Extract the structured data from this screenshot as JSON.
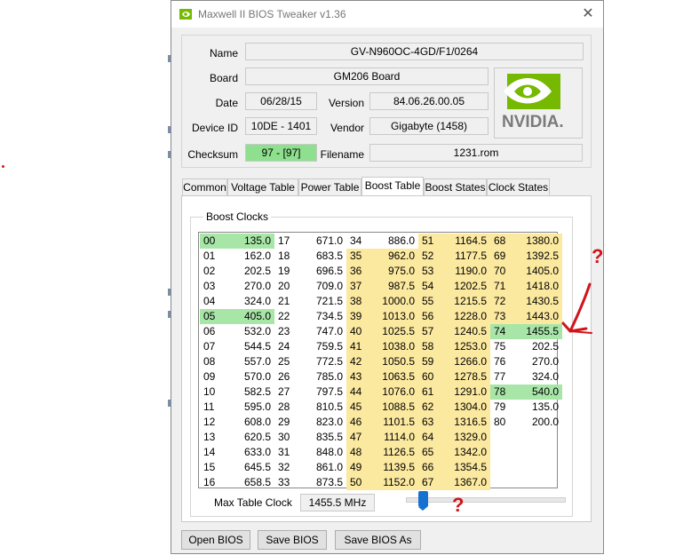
{
  "window": {
    "title": "Maxwell II BIOS Tweaker v1.36",
    "close_glyph": "✕"
  },
  "info": {
    "name_label": "Name",
    "name_value": "GV-N960OC-4GD/F1/0264",
    "board_label": "Board",
    "board_value": "GM206 Board",
    "date_label": "Date",
    "date_value": "06/28/15",
    "version_label": "Version",
    "version_value": "84.06.26.00.05",
    "device_label": "Device ID",
    "device_value": "10DE - 1401",
    "vendor_label": "Vendor",
    "vendor_value": "Gigabyte (1458)",
    "checksum_label": "Checksum",
    "checksum_value": "97 - [97]",
    "filename_label": "Filename",
    "filename_value": "1231.rom",
    "logo_text": "NVIDIA.",
    "logo_color": "#76b900"
  },
  "tabs": [
    "Common",
    "Voltage Table",
    "Power Table",
    "Boost Table",
    "Boost States",
    "Clock States"
  ],
  "active_tab": "Boost Table",
  "boost": {
    "group_title": "Boost Clocks",
    "columns": [
      [
        [
          "00",
          "135.0",
          "g"
        ],
        [
          "01",
          "162.0",
          ""
        ],
        [
          "02",
          "202.5",
          ""
        ],
        [
          "03",
          "270.0",
          ""
        ],
        [
          "04",
          "324.0",
          ""
        ],
        [
          "05",
          "405.0",
          "g"
        ],
        [
          "06",
          "532.0",
          ""
        ],
        [
          "07",
          "544.5",
          ""
        ],
        [
          "08",
          "557.0",
          ""
        ],
        [
          "09",
          "570.0",
          ""
        ],
        [
          "10",
          "582.5",
          ""
        ],
        [
          "11",
          "595.0",
          ""
        ],
        [
          "12",
          "608.0",
          ""
        ],
        [
          "13",
          "620.5",
          ""
        ],
        [
          "14",
          "633.0",
          ""
        ],
        [
          "15",
          "645.5",
          ""
        ],
        [
          "16",
          "658.5",
          ""
        ]
      ],
      [
        [
          "17",
          "671.0",
          ""
        ],
        [
          "18",
          "683.5",
          ""
        ],
        [
          "19",
          "696.5",
          ""
        ],
        [
          "20",
          "709.0",
          ""
        ],
        [
          "21",
          "721.5",
          ""
        ],
        [
          "22",
          "734.5",
          ""
        ],
        [
          "23",
          "747.0",
          ""
        ],
        [
          "24",
          "759.5",
          ""
        ],
        [
          "25",
          "772.5",
          ""
        ],
        [
          "26",
          "785.0",
          ""
        ],
        [
          "27",
          "797.5",
          ""
        ],
        [
          "28",
          "810.5",
          ""
        ],
        [
          "29",
          "823.0",
          ""
        ],
        [
          "30",
          "835.5",
          ""
        ],
        [
          "31",
          "848.0",
          ""
        ],
        [
          "32",
          "861.0",
          ""
        ],
        [
          "33",
          "873.5",
          ""
        ]
      ],
      [
        [
          "34",
          "886.0",
          ""
        ],
        [
          "35",
          "962.0",
          "y"
        ],
        [
          "36",
          "975.0",
          "y"
        ],
        [
          "37",
          "987.5",
          "y"
        ],
        [
          "38",
          "1000.0",
          "y"
        ],
        [
          "39",
          "1013.0",
          "y"
        ],
        [
          "40",
          "1025.5",
          "y"
        ],
        [
          "41",
          "1038.0",
          "y"
        ],
        [
          "42",
          "1050.5",
          "y"
        ],
        [
          "43",
          "1063.5",
          "y"
        ],
        [
          "44",
          "1076.0",
          "y"
        ],
        [
          "45",
          "1088.5",
          "y"
        ],
        [
          "46",
          "1101.5",
          "y"
        ],
        [
          "47",
          "1114.0",
          "y"
        ],
        [
          "48",
          "1126.5",
          "y"
        ],
        [
          "49",
          "1139.5",
          "y"
        ],
        [
          "50",
          "1152.0",
          "y"
        ]
      ],
      [
        [
          "51",
          "1164.5",
          "y"
        ],
        [
          "52",
          "1177.5",
          "y"
        ],
        [
          "53",
          "1190.0",
          "y"
        ],
        [
          "54",
          "1202.5",
          "y"
        ],
        [
          "55",
          "1215.5",
          "y"
        ],
        [
          "56",
          "1228.0",
          "y"
        ],
        [
          "57",
          "1240.5",
          "y"
        ],
        [
          "58",
          "1253.0",
          "y"
        ],
        [
          "59",
          "1266.0",
          "y"
        ],
        [
          "60",
          "1278.5",
          "y"
        ],
        [
          "61",
          "1291.0",
          "y"
        ],
        [
          "62",
          "1304.0",
          "y"
        ],
        [
          "63",
          "1316.5",
          "y"
        ],
        [
          "64",
          "1329.0",
          "y"
        ],
        [
          "65",
          "1342.0",
          "y"
        ],
        [
          "66",
          "1354.5",
          "y"
        ],
        [
          "67",
          "1367.0",
          "y"
        ]
      ],
      [
        [
          "68",
          "1380.0",
          "y"
        ],
        [
          "69",
          "1392.5",
          "y"
        ],
        [
          "70",
          "1405.0",
          "y"
        ],
        [
          "71",
          "1418.0",
          "y"
        ],
        [
          "72",
          "1430.5",
          "y"
        ],
        [
          "73",
          "1443.0",
          "y"
        ],
        [
          "74",
          "1455.5",
          "g"
        ],
        [
          "75",
          "202.5",
          ""
        ],
        [
          "76",
          "270.0",
          ""
        ],
        [
          "77",
          "324.0",
          ""
        ],
        [
          "78",
          "540.0",
          "g"
        ],
        [
          "79",
          "135.0",
          ""
        ],
        [
          "80",
          "200.0",
          ""
        ]
      ]
    ],
    "max_label": "Max Table Clock",
    "max_value": "1455.5 MHz"
  },
  "buttons": {
    "open": "Open BIOS",
    "save": "Save BIOS",
    "save_as": "Save BIOS As"
  },
  "annotations": {
    "question": "?",
    "color": "#d0141a"
  }
}
